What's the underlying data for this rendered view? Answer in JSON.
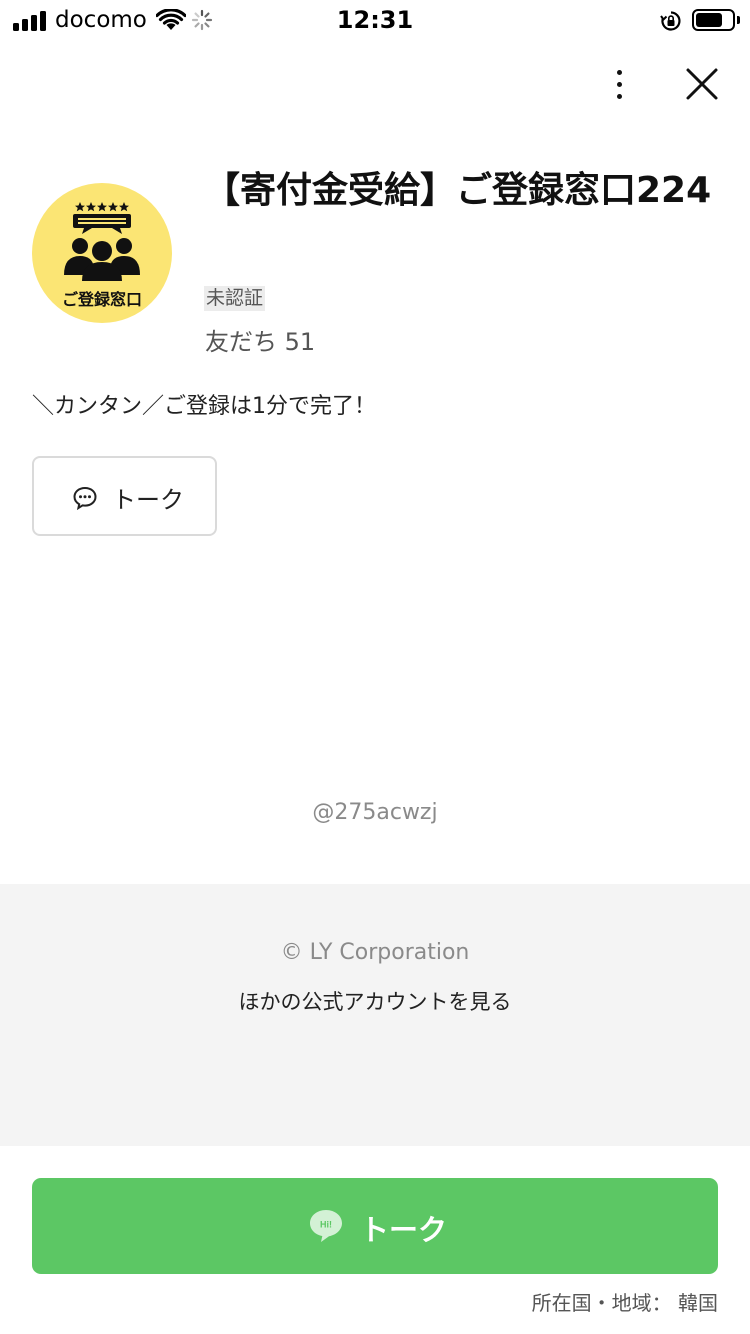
{
  "status_bar": {
    "carrier": "docomo",
    "time": "12:31",
    "battery_level": 0.75
  },
  "profile": {
    "name": "【寄付金受給】ご登録窓口224",
    "avatar_caption": "ご登録窓口",
    "badge": "未認証",
    "friends": "友だち 51",
    "description": "＼カンタン／ご登録は1分で完了！"
  },
  "actions": {
    "talk_label": "トーク",
    "main_talk_label": "トーク",
    "more_icon": "more-vertical-icon",
    "close_icon": "close-icon"
  },
  "account_id": "@275acwzj",
  "footer": {
    "copyright": "© LY Corporation",
    "other_accounts": "ほかの公式アカウントを見る"
  },
  "location": "所在国・地域： 韓国",
  "colors": {
    "accent_green": "#5cc764",
    "avatar_bg": "#fbe574",
    "footer_bg": "#f4f4f4"
  }
}
